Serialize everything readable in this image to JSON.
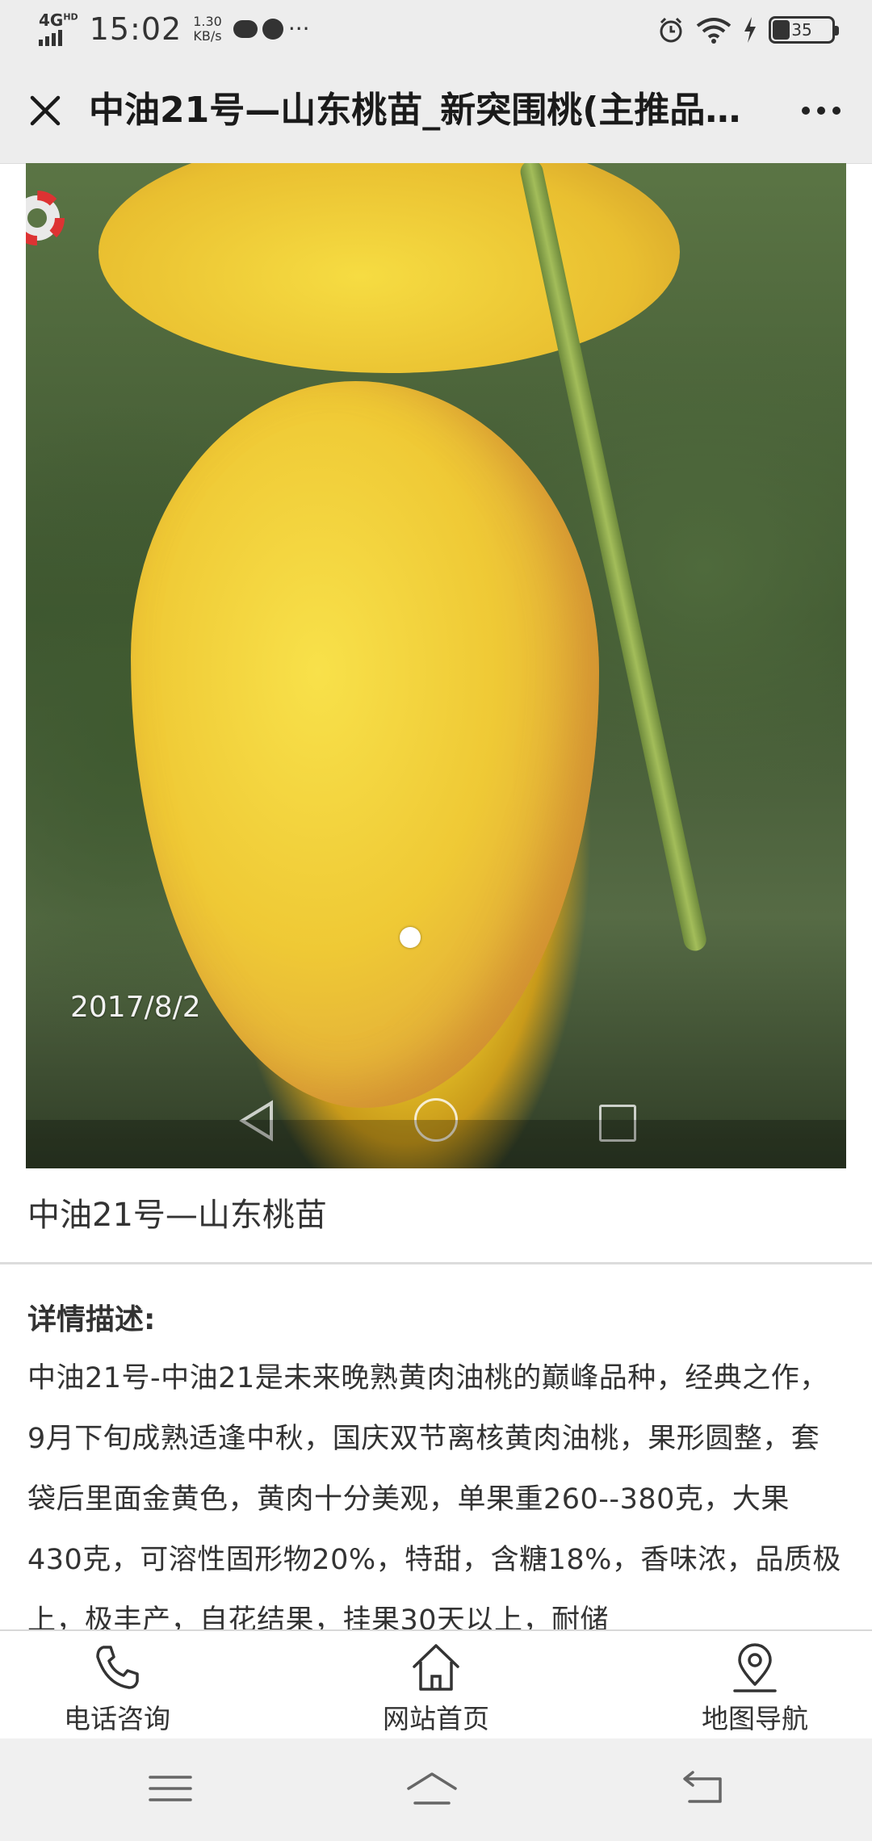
{
  "status_bar": {
    "network": "4G",
    "network_sup": "HD",
    "time": "15:02",
    "speed_value": "1.30",
    "speed_unit": "KB/s",
    "more_indicator": "···",
    "battery_level": "35"
  },
  "header": {
    "title": "中油21号—山东桃苗_新突围桃(主推品…",
    "close_icon": "close-icon",
    "more_icon": "more-icon"
  },
  "gallery": {
    "watermark_date": "2017/8/2",
    "current_index": 1,
    "total": 1
  },
  "product": {
    "name": "中油21号—山东桃苗"
  },
  "details": {
    "heading": "详情描述:",
    "text": "中油21号-中油21是未来晚熟黄肉油桃的巅峰品种，经典之作，9月下旬成熟适逢中秋，国庆双节离核黄肉油桃，果形圆整，套袋后里面金黄色，黄肉十分美观，单果重260--380克，大果430克，可溶性固形物20%，特甜，含糖18%，香味浓，品质极上，极丰产，自花结果，挂果30天以上，耐储"
  },
  "action_bar": {
    "items": [
      {
        "label": "电话咨询",
        "icon": "phone-icon"
      },
      {
        "label": "网站首页",
        "icon": "home-icon"
      },
      {
        "label": "地图导航",
        "icon": "map-pin-icon"
      }
    ]
  },
  "system_nav": {
    "buttons": [
      "menu-icon",
      "home-icon",
      "back-icon"
    ]
  }
}
